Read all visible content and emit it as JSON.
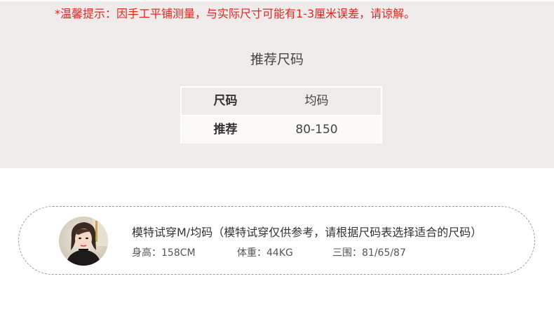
{
  "notice": "*温馨提示：因手工平铺测量，与实际尺寸可能有1-3厘米误差，请谅解。",
  "section_title": "推荐尺码",
  "size_table": {
    "header": {
      "label": "尺码",
      "value": "均码"
    },
    "row": {
      "label": "推荐",
      "value": "80-150"
    }
  },
  "model": {
    "title": "模特试穿M/均码（模特试穿仅供参考，请根据尺码表选择适合的尺码）",
    "height": "身高：158CM",
    "weight": "体重：44KG",
    "measurements": "三围：81/65/87"
  },
  "colors": {
    "notice": "#e5231e",
    "top_background": "#efebeb",
    "card_border": "#9a9a9a"
  }
}
